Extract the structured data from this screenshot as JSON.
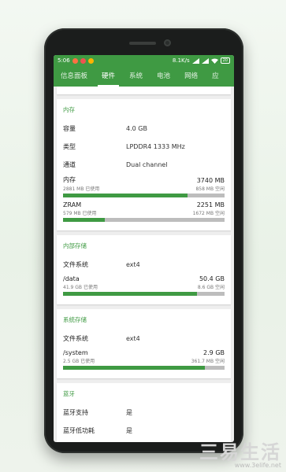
{
  "status": {
    "time": "5:06",
    "speed": "8.1K/s",
    "battery": "20"
  },
  "tabs": [
    {
      "label": "信息面板"
    },
    {
      "label": "硬件"
    },
    {
      "label": "系统"
    },
    {
      "label": "电池"
    },
    {
      "label": "网络"
    },
    {
      "label": "应"
    }
  ],
  "memory": {
    "title": "内存",
    "rows": [
      {
        "key": "容量",
        "value": "4.0 GB"
      },
      {
        "key": "类型",
        "value": "LPDDR4 1333 MHz"
      },
      {
        "key": "通道",
        "value": "Dual channel"
      }
    ],
    "ram": {
      "name": "内存",
      "total": "3740 MB",
      "used": "2881 MB 已使用",
      "free": "858 MB 空闲",
      "fraction": 0.77
    },
    "zram": {
      "name": "ZRAM",
      "total": "2251 MB",
      "used": "579 MB 已使用",
      "free": "1672 MB 空闲",
      "fraction": 0.26
    }
  },
  "internal": {
    "title": "内部存储",
    "fs_key": "文件系统",
    "fs_value": "ext4",
    "data": {
      "name": "/data",
      "total": "50.4 GB",
      "used": "41.9 GB 已使用",
      "free": "8.6 GB 空闲",
      "fraction": 0.83
    }
  },
  "system": {
    "title": "系统存储",
    "fs_key": "文件系统",
    "fs_value": "ext4",
    "sys": {
      "name": "/system",
      "total": "2.9 GB",
      "used": "2.5 GB 已使用",
      "free": "361.7 MB 空闲",
      "fraction": 0.88
    }
  },
  "bluetooth": {
    "title": "蓝牙",
    "support_key": "蓝牙支持",
    "support_value": "是",
    "next_key": "蓝牙低功耗",
    "next_value": "是"
  },
  "watermark": {
    "main": "三易生活",
    "url": "www.3elife.net"
  },
  "colors": {
    "accent": "#3f9a43",
    "bar_bg": "#bdbdbd"
  }
}
